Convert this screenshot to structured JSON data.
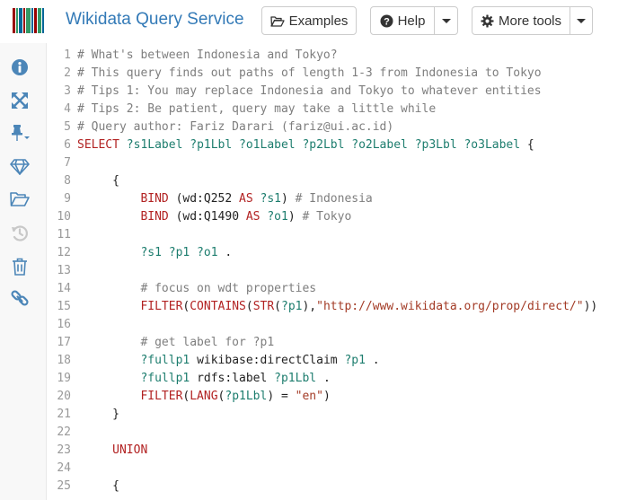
{
  "header": {
    "title": "Wikidata Query Service",
    "examples_label": "Examples",
    "help_label": "Help",
    "more_tools_label": "More tools"
  },
  "colors": {
    "logo_bars": [
      "#990000",
      "#339966",
      "#006699",
      "#990000",
      "#339966",
      "#006699",
      "#990000",
      "#339966",
      "#006699"
    ],
    "link": "#337ab7",
    "sidebar_icon": "#4c86b8",
    "sidebar_icon_disabled": "#c8c8c8"
  },
  "sidebar": {
    "icons": [
      "info-icon",
      "expand-icon",
      "pin-icon",
      "diamond-icon",
      "folder-open-icon",
      "history-icon",
      "trash-icon",
      "link-icon"
    ]
  },
  "editor": {
    "lines": [
      {
        "n": "1",
        "parts": [
          {
            "c": "com",
            "t": "# What's between Indonesia and Tokyo?"
          }
        ]
      },
      {
        "n": "2",
        "parts": [
          {
            "c": "com",
            "t": "# This query finds out paths of length 1-3 from Indonesia to Tokyo"
          }
        ]
      },
      {
        "n": "3",
        "parts": [
          {
            "c": "com",
            "t": "# Tips 1: You may replace Indonesia and Tokyo to whatever entities"
          }
        ]
      },
      {
        "n": "4",
        "parts": [
          {
            "c": "com",
            "t": "# Tips 2: Be patient, query may take a little while"
          }
        ]
      },
      {
        "n": "5",
        "parts": [
          {
            "c": "com",
            "t": "# Query author: Fariz Darari (fariz@ui.ac.id)"
          }
        ]
      },
      {
        "n": "6",
        "parts": [
          {
            "c": "kw",
            "t": "SELECT "
          },
          {
            "c": "var",
            "t": "?s1Label ?p1Lbl ?o1Label ?p2Lbl ?o2Label ?p3Lbl ?o3Label "
          },
          {
            "c": "plain",
            "t": "{"
          }
        ]
      },
      {
        "n": "7",
        "parts": []
      },
      {
        "n": "8",
        "parts": [
          {
            "c": "plain",
            "t": "     {"
          }
        ]
      },
      {
        "n": "9",
        "parts": [
          {
            "c": "kw",
            "t": "         BIND "
          },
          {
            "c": "plain",
            "t": "(wd:Q252 "
          },
          {
            "c": "kw",
            "t": "AS "
          },
          {
            "c": "var",
            "t": "?s1"
          },
          {
            "c": "plain",
            "t": ") "
          },
          {
            "c": "com",
            "t": "# Indonesia"
          }
        ]
      },
      {
        "n": "10",
        "parts": [
          {
            "c": "kw",
            "t": "         BIND "
          },
          {
            "c": "plain",
            "t": "(wd:Q1490 "
          },
          {
            "c": "kw",
            "t": "AS "
          },
          {
            "c": "var",
            "t": "?o1"
          },
          {
            "c": "plain",
            "t": ") "
          },
          {
            "c": "com",
            "t": "# Tokyo"
          }
        ]
      },
      {
        "n": "11",
        "parts": []
      },
      {
        "n": "12",
        "parts": [
          {
            "c": "var",
            "t": "         ?s1 ?p1 ?o1 "
          },
          {
            "c": "plain",
            "t": "."
          }
        ]
      },
      {
        "n": "13",
        "parts": []
      },
      {
        "n": "14",
        "parts": [
          {
            "c": "com",
            "t": "         # focus on wdt properties"
          }
        ]
      },
      {
        "n": "15",
        "parts": [
          {
            "c": "kw",
            "t": "         FILTER"
          },
          {
            "c": "plain",
            "t": "("
          },
          {
            "c": "kw",
            "t": "CONTAINS"
          },
          {
            "c": "plain",
            "t": "("
          },
          {
            "c": "kw",
            "t": "STR"
          },
          {
            "c": "plain",
            "t": "("
          },
          {
            "c": "var",
            "t": "?p1"
          },
          {
            "c": "plain",
            "t": "),"
          },
          {
            "c": "str",
            "t": "\"http://www.wikidata.org/prop/direct/\""
          },
          {
            "c": "plain",
            "t": "))"
          }
        ]
      },
      {
        "n": "16",
        "parts": []
      },
      {
        "n": "17",
        "parts": [
          {
            "c": "com",
            "t": "         # get label for ?p1"
          }
        ]
      },
      {
        "n": "18",
        "parts": [
          {
            "c": "var",
            "t": "         ?fullp1 "
          },
          {
            "c": "plain",
            "t": "wikibase:directClaim "
          },
          {
            "c": "var",
            "t": "?p1 "
          },
          {
            "c": "plain",
            "t": "."
          }
        ]
      },
      {
        "n": "19",
        "parts": [
          {
            "c": "var",
            "t": "         ?fullp1 "
          },
          {
            "c": "plain",
            "t": "rdfs:label "
          },
          {
            "c": "var",
            "t": "?p1Lbl "
          },
          {
            "c": "plain",
            "t": "."
          }
        ]
      },
      {
        "n": "20",
        "parts": [
          {
            "c": "kw",
            "t": "         FILTER"
          },
          {
            "c": "plain",
            "t": "("
          },
          {
            "c": "kw",
            "t": "LANG"
          },
          {
            "c": "plain",
            "t": "("
          },
          {
            "c": "var",
            "t": "?p1Lbl"
          },
          {
            "c": "plain",
            "t": ") = "
          },
          {
            "c": "str",
            "t": "\"en\""
          },
          {
            "c": "plain",
            "t": ")"
          }
        ]
      },
      {
        "n": "21",
        "parts": [
          {
            "c": "plain",
            "t": "     }"
          }
        ]
      },
      {
        "n": "22",
        "parts": []
      },
      {
        "n": "23",
        "parts": [
          {
            "c": "kw",
            "t": "     UNION"
          }
        ]
      },
      {
        "n": "24",
        "parts": []
      },
      {
        "n": "25",
        "parts": [
          {
            "c": "plain",
            "t": "     {"
          }
        ]
      }
    ]
  }
}
